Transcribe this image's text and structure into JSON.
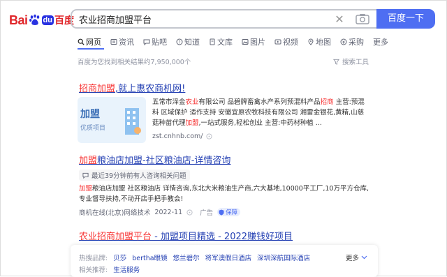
{
  "logo": {
    "bai": "Bai",
    "du": "du",
    "cn": "百度"
  },
  "search": {
    "query": "农业招商加盟平台",
    "button_label": "百度一下"
  },
  "tabs": [
    {
      "label": "网页",
      "icon": "search-icon",
      "active": true
    },
    {
      "label": "资讯",
      "icon": "news-icon"
    },
    {
      "label": "贴吧",
      "icon": "tieba-icon"
    },
    {
      "label": "知道",
      "icon": "zhidao-icon"
    },
    {
      "label": "文库",
      "icon": "wenku-icon"
    },
    {
      "label": "图片",
      "icon": "image-icon"
    },
    {
      "label": "视频",
      "icon": "video-icon"
    },
    {
      "label": "地图",
      "icon": "map-icon"
    },
    {
      "label": "采购",
      "icon": "purchase-icon"
    },
    {
      "label": "更多"
    }
  ],
  "result_count": "百度为您找到相关结果约7,950,000个",
  "search_tools": "搜索工具",
  "results": [
    {
      "title_hl": "招商加盟",
      "title_rest": ",就上惠农商机网!",
      "thumb_t1": "加盟",
      "thumb_t2": "优质项目",
      "desc_1a": "五常市泽金",
      "desc_1hl": "农业",
      "desc_1b": "有限公司 品碧牌畜禽水产系列预混料产品",
      "desc_1hl2": "招商",
      "desc_1c": " 主营:预混",
      "desc_2": "料 区域保护 适作支持 安徽宜原农牧科技有限公司 湘雷金银花,黄精,山慈",
      "desc_3a": "菇种苗代理",
      "desc_3hl": "加盟",
      "desc_3b": ",一站式服务,轻松创业 主营:中药材种植 ...",
      "source": "zst.cnhnb.com/"
    },
    {
      "title_hl": "加盟",
      "title_rest": "粮油店加盟-社区粮油店-详情咨询",
      "chip": "最近39分钟前有人咨询相关问题",
      "desc_1a": "",
      "desc_1hl": "加盟",
      "desc_1b": "粮油店加盟 社区粮油店 详情咨询,东北大米粮油生产商,六大基地,10000平工厂,10万平方仓库,",
      "desc_2": "专业督导扶持,不动开店手把手教会!",
      "source": "商机在线(北京)网络技术",
      "date": "2022-11",
      "ad": "广告",
      "badge": "保障"
    },
    {
      "title_hl": "农业招商加盟平台",
      "title_rest": " - 加盟项目精选 - 2022赚钱好项目"
    }
  ],
  "hot_panel": {
    "label_1": "热搜品牌:",
    "brands": [
      "贝莎",
      "bertha眼镜",
      "悠兰碧尔",
      "将军澳假日酒店",
      "深圳深航国际酒店"
    ],
    "more": "更多",
    "label_2": "相关推荐:",
    "recommend": [
      "生活服务"
    ]
  },
  "colors": {
    "accent": "#4e6ef2",
    "link": "#2440b3",
    "highlight": "#f73131",
    "logo_red": "#e0262a"
  }
}
